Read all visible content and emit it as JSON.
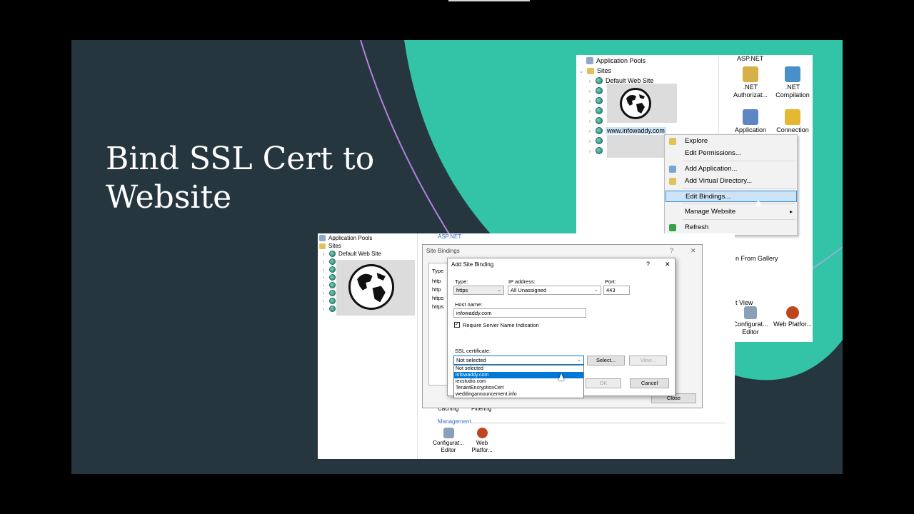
{
  "slide": {
    "title": "Bind SSL Cert to Website"
  },
  "top_shot": {
    "tree": {
      "app_pools": "Application Pools",
      "sites": "Sites",
      "default_site": "Default Web Site",
      "site": "www.infowaddy.com"
    },
    "features": {
      "section": "ASP.NET",
      "net_auth": ".NET Authorizat...",
      "net_comp": ".NET Compilation",
      "application": "Application",
      "connection": "Connection",
      "config_editor": "Configurat... Editor",
      "web_platform": "Web Platfor..."
    },
    "context_menu": {
      "explore": "Explore",
      "edit_permissions": "Edit Permissions...",
      "add_application": "Add Application...",
      "add_vdir": "Add Virtual Directory...",
      "edit_bindings": "Edit Bindings...",
      "manage_website": "Manage Website",
      "refresh": "Refresh"
    },
    "partial": {
      "from_gallery": "n From Gallery",
      "list_view": "t View"
    }
  },
  "bottom_shot": {
    "tree": {
      "app_pools": "Application Pools",
      "sites": "Sites",
      "default_site": "Default Web Site"
    },
    "section": "ASP.NET",
    "caching": "Caching",
    "filtering": "Filtering",
    "management": "Management",
    "config_editor": "Configurat... Editor",
    "web_platform": "Web Platfor..."
  },
  "site_bindings": {
    "title": "Site Bindings",
    "help": "?",
    "close_x": "✕",
    "type_header": "Type",
    "rows": [
      "http",
      "http",
      "https",
      "https"
    ],
    "close_button": "Close"
  },
  "add_site_binding": {
    "title": "Add Site Binding",
    "help": "?",
    "close_x": "✕",
    "type_label": "Type:",
    "type_value": "https",
    "ip_label": "IP address:",
    "ip_value": "All Unassigned",
    "port_label": "Port:",
    "port_value": "443",
    "host_label": "Host name:",
    "host_value": "infowaddy.com",
    "sni_label": "Require Server Name Indication",
    "ssl_label": "SSL certificate:",
    "ssl_selected": "Not selected",
    "ssl_options": [
      "Not selected",
      "infowaddy.com",
      "iexstudio.com",
      "TenantEncryptionCert",
      "weddingannouncement.info"
    ],
    "select_button": "Select...",
    "view_button": "View...",
    "ok_button": "OK",
    "cancel_button": "Cancel"
  }
}
